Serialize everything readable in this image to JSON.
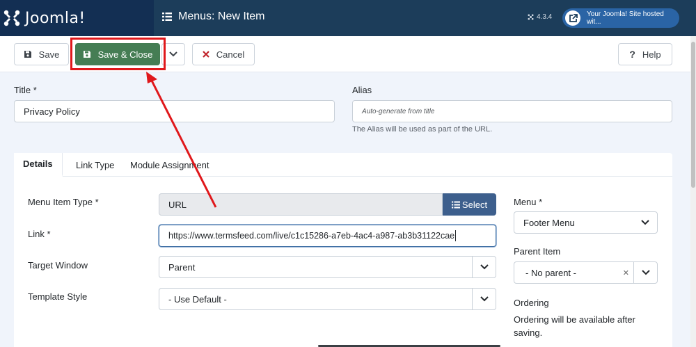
{
  "header": {
    "logo_text": "Joomla!",
    "page_title": "Menus: New Item",
    "version": "4.3.4",
    "site_link": "Your Joomla! Site hosted wit..."
  },
  "toolbar": {
    "save_label": "Save",
    "save_close_label": "Save & Close",
    "cancel_label": "Cancel",
    "help_label": "Help",
    "save_close_color": "#457d54"
  },
  "form": {
    "title_label": "Title *",
    "title_value": "Privacy Policy",
    "alias_label": "Alias",
    "alias_placeholder": "Auto-generate from title",
    "alias_help": "The Alias will be used as part of the URL."
  },
  "tabs": [
    {
      "label": "Details",
      "active": true
    },
    {
      "label": "Link Type",
      "active": false
    },
    {
      "label": "Module Assignment",
      "active": false
    }
  ],
  "details": {
    "menu_item_type_label": "Menu Item Type *",
    "menu_item_type_value": "URL",
    "select_button_label": "Select",
    "link_label": "Link *",
    "link_value": "https://www.termsfeed.com/live/c1c15286-a7eb-4ac4-a987-ab3b31122cae",
    "target_window_label": "Target Window",
    "target_window_value": "Parent",
    "template_style_label": "Template Style",
    "template_style_value": "- Use Default -"
  },
  "sidebar": {
    "menu_label": "Menu *",
    "menu_value": "Footer Menu",
    "parent_label": "Parent Item",
    "parent_value": "- No parent -",
    "ordering_label": "Ordering",
    "ordering_text": "Ordering will be available after saving."
  },
  "colors": {
    "header_bg": "#1c3d5a",
    "logo_bg": "#132f53",
    "annotation_red": "#e0181b",
    "select_button_bg": "#3d5f8d"
  },
  "icons": [
    "joomla-logo-icon",
    "list-icon",
    "joomla-small-icon",
    "external-link-icon",
    "save-icon",
    "chevron-down-icon",
    "close-icon",
    "question-icon",
    "list-select-icon",
    "clear-icon"
  ]
}
